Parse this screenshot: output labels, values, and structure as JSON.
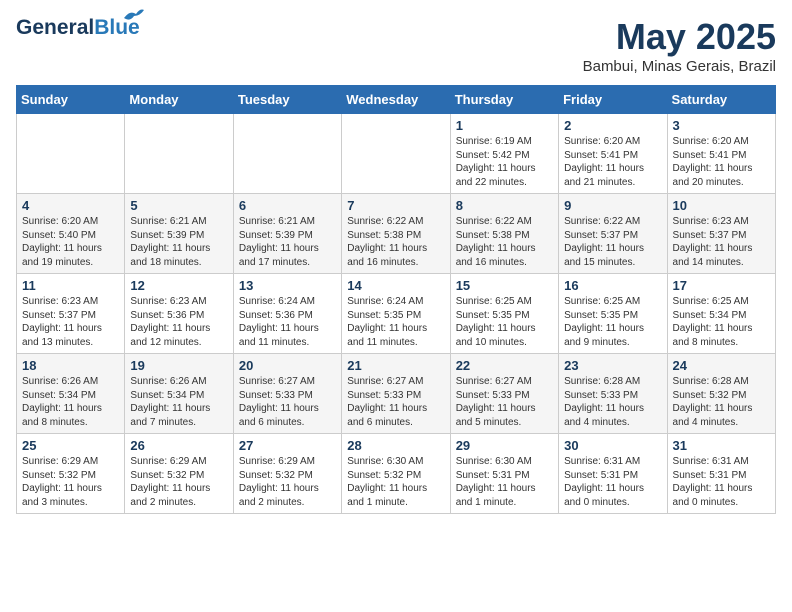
{
  "header": {
    "logo_general": "General",
    "logo_blue": "Blue",
    "month": "May 2025",
    "location": "Bambui, Minas Gerais, Brazil"
  },
  "weekdays": [
    "Sunday",
    "Monday",
    "Tuesday",
    "Wednesday",
    "Thursday",
    "Friday",
    "Saturday"
  ],
  "weeks": [
    [
      {
        "day": "",
        "info": ""
      },
      {
        "day": "",
        "info": ""
      },
      {
        "day": "",
        "info": ""
      },
      {
        "day": "",
        "info": ""
      },
      {
        "day": "1",
        "info": "Sunrise: 6:19 AM\nSunset: 5:42 PM\nDaylight: 11 hours\nand 22 minutes."
      },
      {
        "day": "2",
        "info": "Sunrise: 6:20 AM\nSunset: 5:41 PM\nDaylight: 11 hours\nand 21 minutes."
      },
      {
        "day": "3",
        "info": "Sunrise: 6:20 AM\nSunset: 5:41 PM\nDaylight: 11 hours\nand 20 minutes."
      }
    ],
    [
      {
        "day": "4",
        "info": "Sunrise: 6:20 AM\nSunset: 5:40 PM\nDaylight: 11 hours\nand 19 minutes."
      },
      {
        "day": "5",
        "info": "Sunrise: 6:21 AM\nSunset: 5:39 PM\nDaylight: 11 hours\nand 18 minutes."
      },
      {
        "day": "6",
        "info": "Sunrise: 6:21 AM\nSunset: 5:39 PM\nDaylight: 11 hours\nand 17 minutes."
      },
      {
        "day": "7",
        "info": "Sunrise: 6:22 AM\nSunset: 5:38 PM\nDaylight: 11 hours\nand 16 minutes."
      },
      {
        "day": "8",
        "info": "Sunrise: 6:22 AM\nSunset: 5:38 PM\nDaylight: 11 hours\nand 16 minutes."
      },
      {
        "day": "9",
        "info": "Sunrise: 6:22 AM\nSunset: 5:37 PM\nDaylight: 11 hours\nand 15 minutes."
      },
      {
        "day": "10",
        "info": "Sunrise: 6:23 AM\nSunset: 5:37 PM\nDaylight: 11 hours\nand 14 minutes."
      }
    ],
    [
      {
        "day": "11",
        "info": "Sunrise: 6:23 AM\nSunset: 5:37 PM\nDaylight: 11 hours\nand 13 minutes."
      },
      {
        "day": "12",
        "info": "Sunrise: 6:23 AM\nSunset: 5:36 PM\nDaylight: 11 hours\nand 12 minutes."
      },
      {
        "day": "13",
        "info": "Sunrise: 6:24 AM\nSunset: 5:36 PM\nDaylight: 11 hours\nand 11 minutes."
      },
      {
        "day": "14",
        "info": "Sunrise: 6:24 AM\nSunset: 5:35 PM\nDaylight: 11 hours\nand 11 minutes."
      },
      {
        "day": "15",
        "info": "Sunrise: 6:25 AM\nSunset: 5:35 PM\nDaylight: 11 hours\nand 10 minutes."
      },
      {
        "day": "16",
        "info": "Sunrise: 6:25 AM\nSunset: 5:35 PM\nDaylight: 11 hours\nand 9 minutes."
      },
      {
        "day": "17",
        "info": "Sunrise: 6:25 AM\nSunset: 5:34 PM\nDaylight: 11 hours\nand 8 minutes."
      }
    ],
    [
      {
        "day": "18",
        "info": "Sunrise: 6:26 AM\nSunset: 5:34 PM\nDaylight: 11 hours\nand 8 minutes."
      },
      {
        "day": "19",
        "info": "Sunrise: 6:26 AM\nSunset: 5:34 PM\nDaylight: 11 hours\nand 7 minutes."
      },
      {
        "day": "20",
        "info": "Sunrise: 6:27 AM\nSunset: 5:33 PM\nDaylight: 11 hours\nand 6 minutes."
      },
      {
        "day": "21",
        "info": "Sunrise: 6:27 AM\nSunset: 5:33 PM\nDaylight: 11 hours\nand 6 minutes."
      },
      {
        "day": "22",
        "info": "Sunrise: 6:27 AM\nSunset: 5:33 PM\nDaylight: 11 hours\nand 5 minutes."
      },
      {
        "day": "23",
        "info": "Sunrise: 6:28 AM\nSunset: 5:33 PM\nDaylight: 11 hours\nand 4 minutes."
      },
      {
        "day": "24",
        "info": "Sunrise: 6:28 AM\nSunset: 5:32 PM\nDaylight: 11 hours\nand 4 minutes."
      }
    ],
    [
      {
        "day": "25",
        "info": "Sunrise: 6:29 AM\nSunset: 5:32 PM\nDaylight: 11 hours\nand 3 minutes."
      },
      {
        "day": "26",
        "info": "Sunrise: 6:29 AM\nSunset: 5:32 PM\nDaylight: 11 hours\nand 2 minutes."
      },
      {
        "day": "27",
        "info": "Sunrise: 6:29 AM\nSunset: 5:32 PM\nDaylight: 11 hours\nand 2 minutes."
      },
      {
        "day": "28",
        "info": "Sunrise: 6:30 AM\nSunset: 5:32 PM\nDaylight: 11 hours\nand 1 minute."
      },
      {
        "day": "29",
        "info": "Sunrise: 6:30 AM\nSunset: 5:31 PM\nDaylight: 11 hours\nand 1 minute."
      },
      {
        "day": "30",
        "info": "Sunrise: 6:31 AM\nSunset: 5:31 PM\nDaylight: 11 hours\nand 0 minutes."
      },
      {
        "day": "31",
        "info": "Sunrise: 6:31 AM\nSunset: 5:31 PM\nDaylight: 11 hours\nand 0 minutes."
      }
    ]
  ]
}
